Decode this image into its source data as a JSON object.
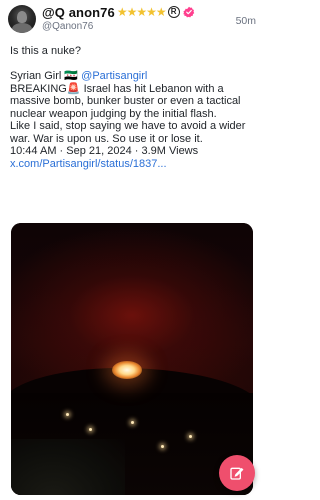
{
  "post": {
    "author": {
      "display_name": "@Q anon76",
      "stars": "★★★★★",
      "registered_mark": "R",
      "handle": "@Qanon76",
      "avatar_icon": "avatar-person-icon"
    },
    "timestamp": "50m",
    "text": {
      "question": "Is this a nuke?",
      "quote_author": "Syrian Girl",
      "quote_flag": "🇸🇾",
      "quote_handle": "@Partisangirl",
      "quote_body_1": "BREAKING🚨 Israel has hit Lebanon with a massive bomb, bunker buster or even a tactical nuclear weapon judging by the initial flash.",
      "quote_body_2": "Like I said, stop saying we have to avoid a wider war. War is upon us. So use it or lose it.",
      "meta": "10:44 AM · Sep 21, 2024 · 3.9M Views",
      "link": "x.com/Partisangirl/status/1837..."
    },
    "media": {
      "description_icon": "night-explosion-photo"
    },
    "fab_icon": "compose-edit-icon"
  },
  "colors": {
    "link": "#2a6fd6",
    "star": "#f2c230",
    "verified": "#ff3f8e",
    "fab": "#ef4f6d"
  }
}
